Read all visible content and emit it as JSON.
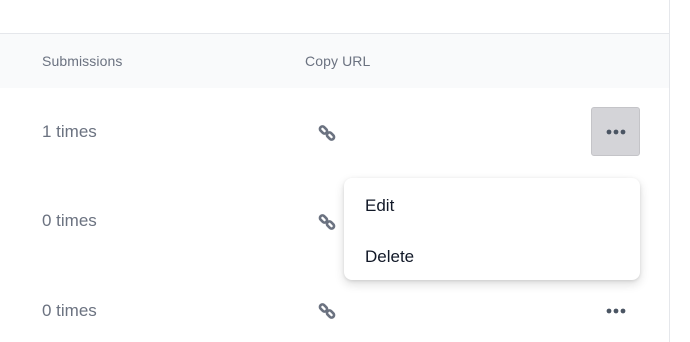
{
  "table": {
    "headers": {
      "submissions": "Submissions",
      "copy_url": "Copy URL"
    },
    "rows": [
      {
        "submissions": "1 times",
        "menu_open": true
      },
      {
        "submissions": "0 times",
        "menu_open": false
      },
      {
        "submissions": "0 times",
        "menu_open": false
      }
    ]
  },
  "menu": {
    "items": [
      "Edit",
      "Delete"
    ]
  },
  "icons": {
    "copy_url": "link-icon",
    "more": "more-horizontal-icon"
  },
  "colors": {
    "header_bg": "#f9fafb",
    "border": "#e5e7eb",
    "muted_text": "#6b7280",
    "icon": "#6b7280",
    "active_button_bg": "#d4d4d8",
    "menu_text": "#111827"
  }
}
